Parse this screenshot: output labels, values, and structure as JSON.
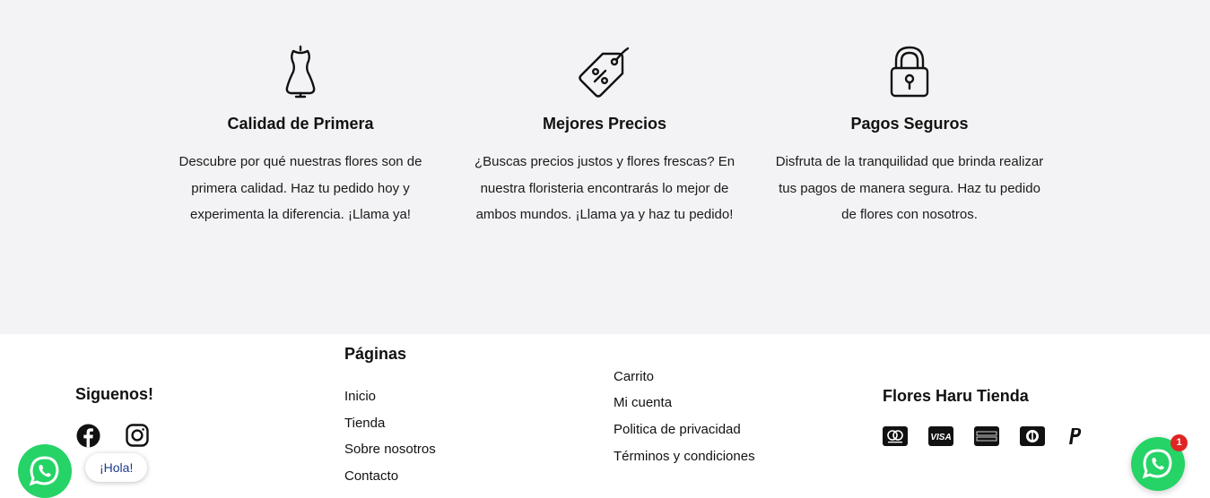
{
  "features": [
    {
      "icon": "mannequin-icon",
      "title": "Calidad de Primera",
      "text": "Descubre por qué nuestras flores son de primera calidad. Haz tu pedido hoy y experimenta la diferencia. ¡Llama ya!"
    },
    {
      "icon": "price-tag-icon",
      "title": "Mejores Precios",
      "text": "¿Buscas precios justos y flores frescas? En nuestra floristeria encontrarás lo mejor de ambos mundos. ¡Llama ya y haz tu pedido!"
    },
    {
      "icon": "padlock-icon",
      "title": "Pagos Seguros",
      "text": "Disfruta de la tranquilidad que brinda realizar tus pagos de manera segura. Haz tu pedido de flores con nosotros."
    }
  ],
  "footer": {
    "social_title": "Siguenos!",
    "social": [
      "facebook-icon",
      "instagram-icon"
    ],
    "pages_title": "Páginas",
    "pages": [
      "Inicio",
      "Tienda",
      "Sobre nosotros",
      "Contacto"
    ],
    "links": [
      "Carrito",
      "Mi cuenta",
      "Politica de privacidad",
      "Términos y condiciones"
    ],
    "store_title": "Flores Haru Tienda",
    "payments": [
      "mastercard-icon",
      "visa-icon",
      "american-express-icon",
      "diners-club-icon",
      "paypal-icon"
    ]
  },
  "chat": {
    "greeting": "¡Hola!",
    "badge_count": "1",
    "accent": "#25d366"
  }
}
